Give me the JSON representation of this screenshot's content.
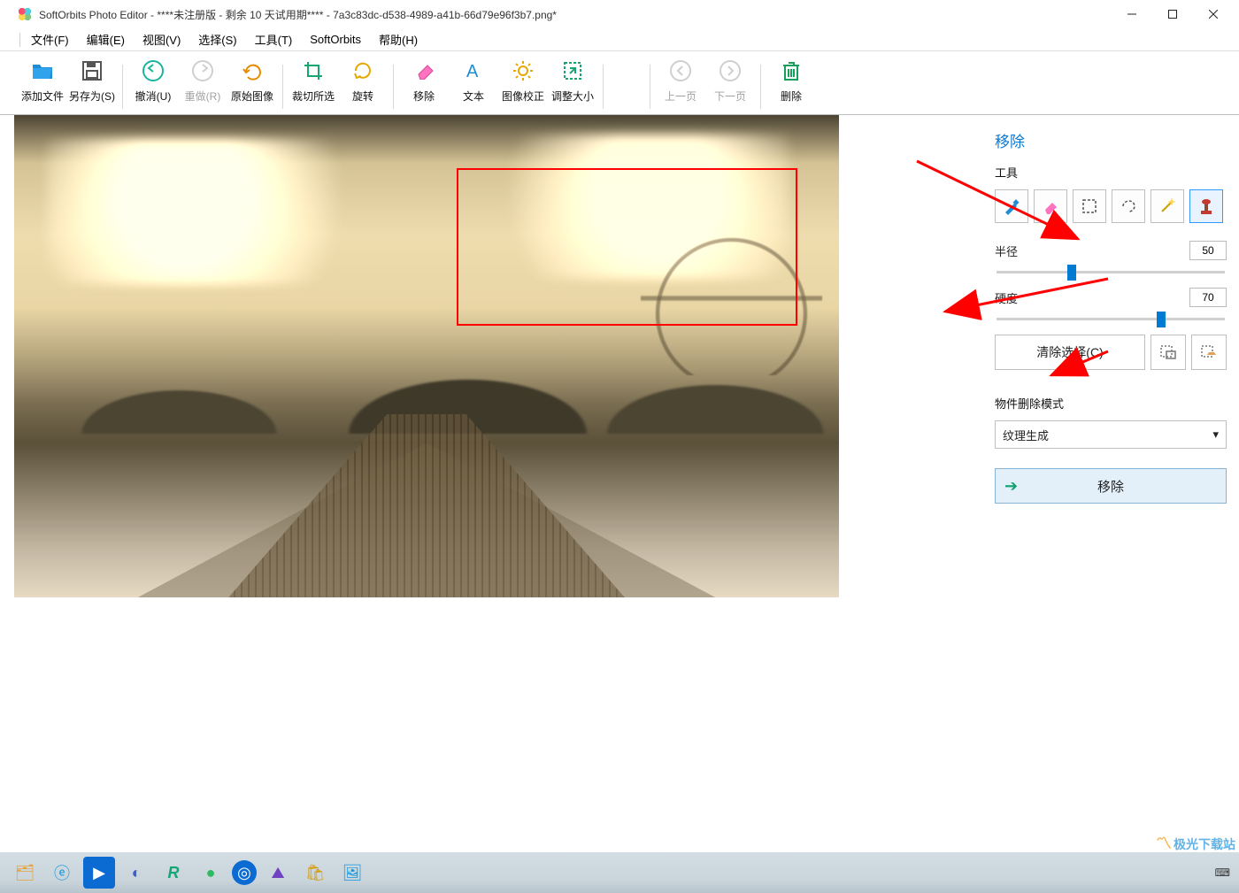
{
  "titlebar": {
    "title": "SoftOrbits Photo Editor - ****未注册版 - 剩余 10 天试用期**** - 7a3c83dc-d538-4989-a41b-66d79e96f3b7.png*"
  },
  "menu": {
    "file": "文件(F)",
    "edit": "编辑(E)",
    "view": "视图(V)",
    "select": "选择(S)",
    "tools": "工具(T)",
    "softorbits": "SoftOrbits",
    "help": "帮助(H)"
  },
  "toolbar": {
    "add_file": "添加文件",
    "save_as": "另存为(S)",
    "undo": "撤消(U)",
    "redo": "重做(R)",
    "original": "原始图像",
    "crop": "裁切所选",
    "rotate": "旋转",
    "remove": "移除",
    "text": "文本",
    "correction": "图像校正",
    "resize": "调整大小",
    "prev": "上一页",
    "next": "下一页",
    "delete": "删除"
  },
  "panel": {
    "title": "移除",
    "tools_label": "工具",
    "radius_label": "半径",
    "radius_value": "50",
    "hardness_label": "硬度",
    "hardness_value": "70",
    "clear_selection": "清除选择(C)",
    "mode_label": "物件删除模式",
    "mode_value": "纹理生成",
    "exec": "移除"
  },
  "watermark": "极光下载站",
  "slider": {
    "radius_pct": 31,
    "hardness_pct": 70
  }
}
